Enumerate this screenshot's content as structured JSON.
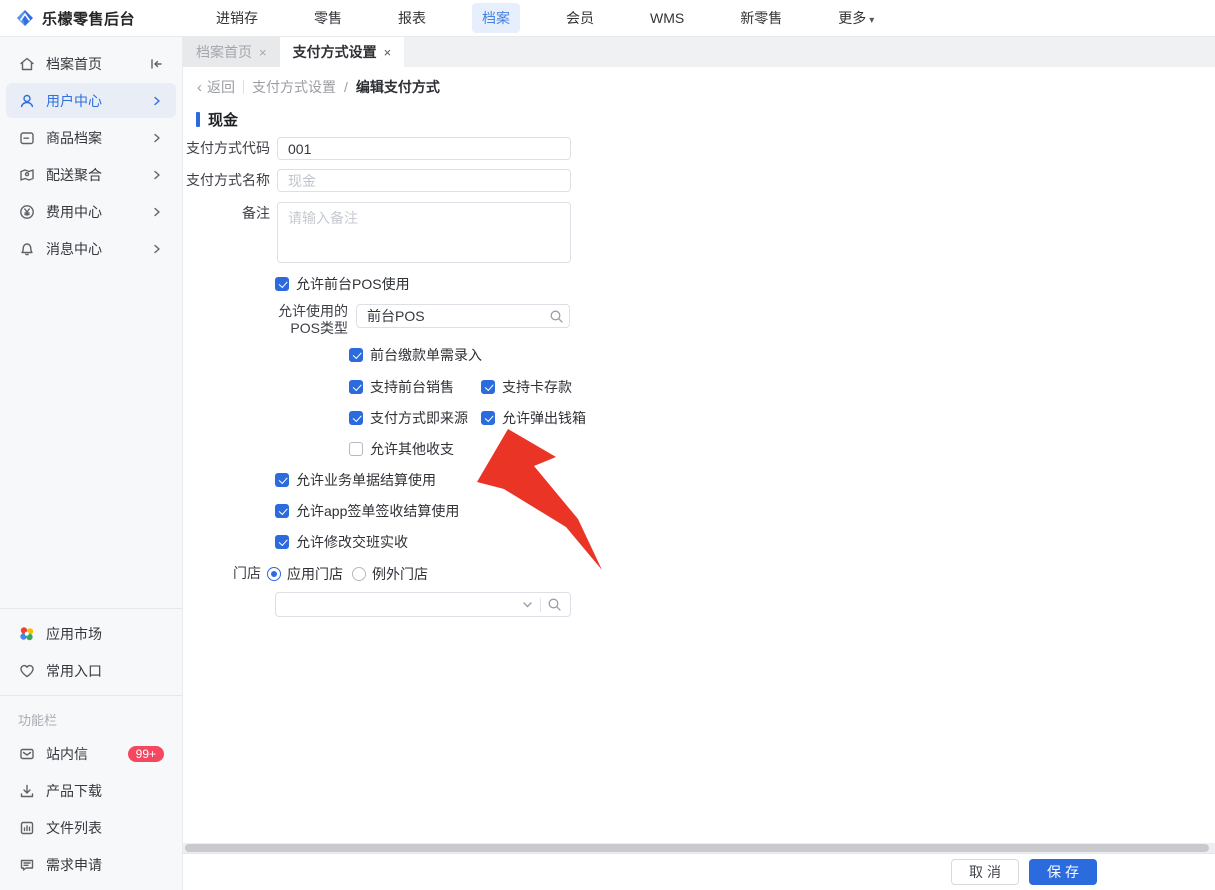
{
  "icons": {
    "close": "×",
    "caret_down": "▾",
    "back_chevron": "‹"
  },
  "topbar": {
    "logo_text": "乐檬零售后台",
    "nav_items": [
      {
        "label": "进销存",
        "active": false
      },
      {
        "label": "零售",
        "active": false
      },
      {
        "label": "报表",
        "active": false
      },
      {
        "label": "档案",
        "active": true
      },
      {
        "label": "会员",
        "active": false
      },
      {
        "label": "WMS",
        "active": false
      },
      {
        "label": "新零售",
        "active": false
      },
      {
        "label": "更多",
        "active": false,
        "has_dropdown": true
      }
    ]
  },
  "sidebar": {
    "main_items": [
      {
        "label": "档案首页",
        "icon": "home-icon",
        "active": false
      },
      {
        "label": "用户中心",
        "icon": "user-icon",
        "active": true,
        "has_children": true
      },
      {
        "label": "商品档案",
        "icon": "goods-icon",
        "active": false,
        "has_children": true
      },
      {
        "label": "配送聚合",
        "icon": "delivery-icon",
        "active": false,
        "has_children": true
      },
      {
        "label": "费用中心",
        "icon": "expense-icon",
        "active": false,
        "has_children": true
      },
      {
        "label": "消息中心",
        "icon": "bell-icon",
        "active": false,
        "has_children": true
      }
    ],
    "secondary_items": [
      {
        "label": "应用市场",
        "icon": "app-market-icon"
      },
      {
        "label": "常用入口",
        "icon": "heart-icon"
      }
    ],
    "section_label": "功能栏",
    "tool_items": [
      {
        "label": "站内信",
        "icon": "mail-icon",
        "badge": "99+"
      },
      {
        "label": "产品下载",
        "icon": "download-icon"
      },
      {
        "label": "文件列表",
        "icon": "file-list-icon"
      },
      {
        "label": "需求申请",
        "icon": "request-icon"
      }
    ]
  },
  "tabs": [
    {
      "label": "档案首页",
      "active": false
    },
    {
      "label": "支付方式设置",
      "active": true
    }
  ],
  "breadcrumb": {
    "back_label": "返回",
    "parent": "支付方式设置",
    "separator": "/",
    "current": "编辑支付方式"
  },
  "form": {
    "section_title": "现金",
    "code": {
      "label": "支付方式代码",
      "value": "001"
    },
    "name": {
      "label": "支付方式名称",
      "value": "现金"
    },
    "remark": {
      "label": "备注",
      "placeholder": "请输入备注"
    },
    "pos_type": {
      "label_line1": "允许使用的",
      "label_line2": "POS类型",
      "value": "前台POS"
    },
    "checkboxes": {
      "pos_use": {
        "label": "允许前台POS使用",
        "checked": true
      },
      "payment_entry": {
        "label": "前台缴款单需录入",
        "checked": true
      },
      "front_sale": {
        "label": "支持前台销售",
        "checked": true
      },
      "card_deposit": {
        "label": "支持卡存款",
        "checked": true
      },
      "payment_source": {
        "label": "支付方式即来源",
        "checked": true
      },
      "popup_cashbox": {
        "label": "允许弹出钱箱",
        "checked": true
      },
      "other_income": {
        "label": "允许其他收支",
        "checked": false
      },
      "business_settle": {
        "label": "允许业务单据结算使用",
        "checked": true
      },
      "app_sign_settle": {
        "label": "允许app签单签收结算使用",
        "checked": true
      },
      "modify_shift": {
        "label": "允许修改交班实收",
        "checked": true
      }
    },
    "store": {
      "label": "门店",
      "options": [
        {
          "label": "应用门店",
          "selected": true
        },
        {
          "label": "例外门店",
          "selected": false
        }
      ]
    },
    "store_select": {
      "value": ""
    }
  },
  "footer": {
    "cancel_label": "取消",
    "save_label": "保存"
  },
  "colors": {
    "primary_blue": "#2b6bde",
    "badge_red": "#f5475f",
    "arrow_red": "#ea3426"
  }
}
